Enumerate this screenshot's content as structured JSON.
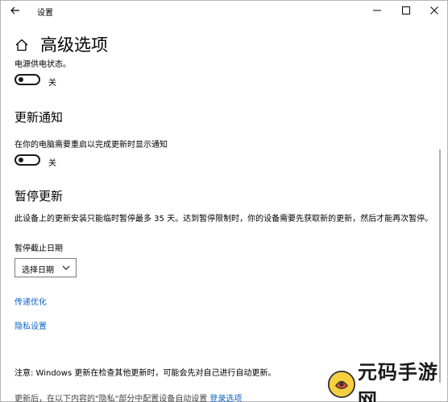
{
  "window": {
    "title": "设置",
    "back_icon": "arrow-left-icon",
    "controls": [
      "minimize-icon",
      "maximize-icon",
      "close-icon"
    ]
  },
  "header": {
    "home_icon": "home-icon",
    "title": "高级选项"
  },
  "power_section": {
    "text": "电源供电状态。",
    "toggle_label": "关",
    "toggle_on": false
  },
  "update_notify": {
    "title": "更新通知",
    "description": "在你的电脑需要重启以完成更新时显示通知",
    "toggle_label": "关",
    "toggle_on": false
  },
  "pause_updates": {
    "title": "暂停更新",
    "description": "此设备上的更新安装只能临时暂停最多 35 天。达到暂停限制时，你的设备需要先获取新的更新，然后才能再次暂停。",
    "date_label": "暂停截止日期",
    "dropdown_value": "选择日期"
  },
  "links": {
    "delivery_optimization": "传递优化",
    "privacy_settings": "隐私设置"
  },
  "note": "注意: Windows 更新在检查其他更新时，可能会先对自己进行自动更新。",
  "footer": {
    "text": "更新后，在以下内容的\"隐私\"部分中配置设备自动设置",
    "link": "登录选项"
  },
  "watermark": {
    "text": "元码手游网",
    "logo_icon": "watermark-logo-icon"
  },
  "colors": {
    "link": "#0b63c4",
    "toggle": "#1a1a1a",
    "background": "#ffffff"
  }
}
